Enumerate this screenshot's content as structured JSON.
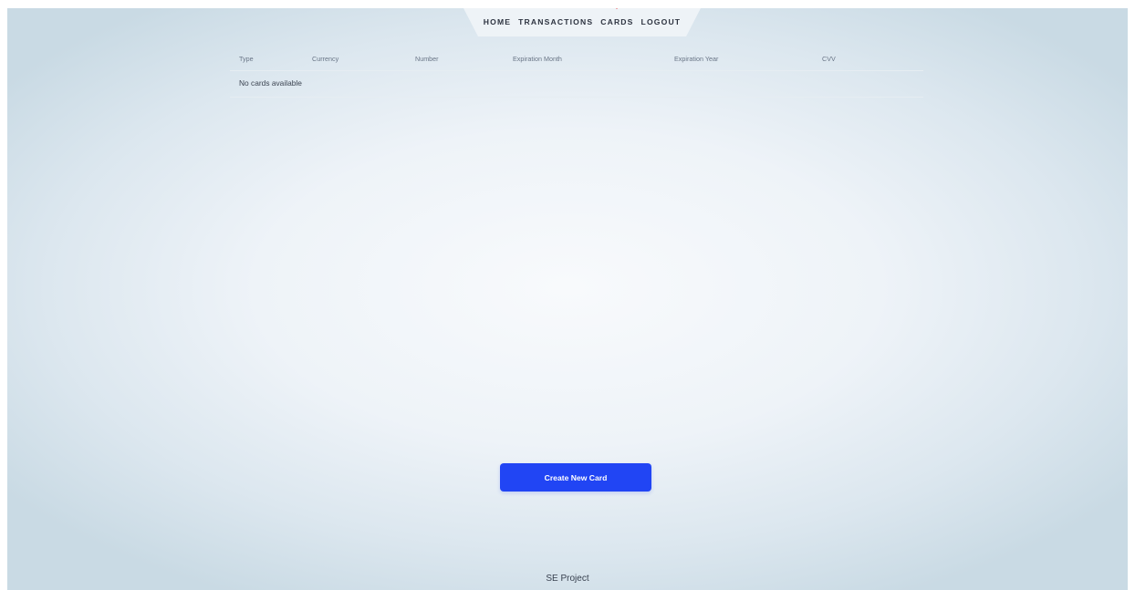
{
  "nav": {
    "items": [
      {
        "label": "HOME"
      },
      {
        "label": "TRANSACTIONS"
      },
      {
        "label": "CARDS",
        "active": true
      },
      {
        "label": "LOGOUT"
      }
    ],
    "active_indicator_color": "#e53535"
  },
  "table": {
    "columns": [
      "Type",
      "Currency",
      "Number",
      "Expiration Month",
      "Expiration Year",
      "CVV"
    ],
    "empty_message": "No cards available"
  },
  "actions": {
    "create_label": "Create New Card",
    "create_color": "#2145f4"
  },
  "footer": {
    "text": "SE Project"
  }
}
